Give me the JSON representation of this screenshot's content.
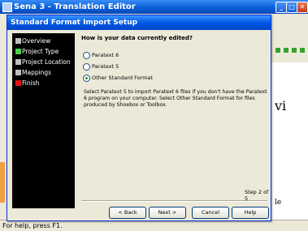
{
  "app": {
    "title": "Sena 3 - Translation Editor",
    "doc_text_1": "vi",
    "doc_text_2": "le",
    "statusbar": "For help, press F1."
  },
  "dialog": {
    "title": "Standard Format Import Setup",
    "steps": [
      {
        "label": "Overview",
        "color": "#c0c0c0"
      },
      {
        "label": "Project Type",
        "color": "#4ccf4c"
      },
      {
        "label": "Project Location",
        "color": "#c0c0c0"
      },
      {
        "label": "Mappings",
        "color": "#c0c0c0"
      },
      {
        "label": "Finish",
        "color": "#e01515"
      }
    ],
    "question": "How is your data currently edited?",
    "options": [
      {
        "label": "Paratext 6",
        "selected": false
      },
      {
        "label": "Paratext 5",
        "selected": false
      },
      {
        "label": "Other Standard Format",
        "selected": true
      }
    ],
    "description": "Select Paratext 5 to import Paratext 6 files if you don't have the Paratext 6 program on your computer. Select Other Standard Format for files produced by Shoebox or Toolbox.",
    "step_indicator": "Step 2 of 5",
    "buttons": {
      "back": "< Back",
      "next": "Next >",
      "cancel": "Cancel",
      "help": "Help"
    }
  }
}
